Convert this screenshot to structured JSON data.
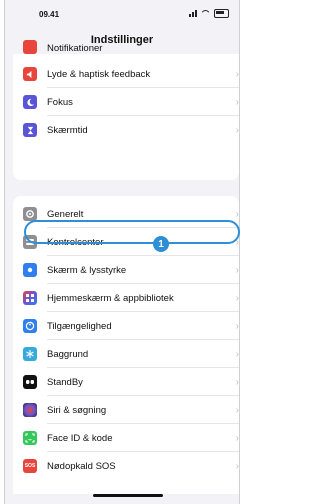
{
  "status": {
    "time": "09.41"
  },
  "header": {
    "title": "Indstillinger"
  },
  "group1": [
    {
      "label": "Notifikationer",
      "icon": "bell-icon",
      "color": "#e8453c"
    },
    {
      "label": "Lyde & haptisk feedback",
      "icon": "speaker-icon",
      "color": "#e8453c"
    },
    {
      "label": "Fokus",
      "icon": "moon-icon",
      "color": "#5a55d6"
    },
    {
      "label": "Skærmtid",
      "icon": "hourglass-icon",
      "color": "#5a55d6"
    }
  ],
  "group2": [
    {
      "label": "Generelt",
      "icon": "gear-icon",
      "color": "#8e8e93"
    },
    {
      "label": "Kontrolcenter",
      "icon": "control-center-icon",
      "color": "#8e8e93"
    },
    {
      "label": "Skærm & lysstyrke",
      "icon": "sun-icon",
      "color": "#2f80ed"
    },
    {
      "label": "Hjemmeskærm & appbibliotek",
      "icon": "grid-icon",
      "color": "#6a55d6"
    },
    {
      "label": "Tilgængelighed",
      "icon": "accessibility-icon",
      "color": "#2f80ed"
    },
    {
      "label": "Baggrund",
      "icon": "snowflake-icon",
      "color": "#36aadc"
    },
    {
      "label": "StandBy",
      "icon": "standby-icon",
      "color": "#111111"
    },
    {
      "label": "Siri & søgning",
      "icon": "siri-icon",
      "color": "#333344"
    },
    {
      "label": "Face ID & kode",
      "icon": "face-id-icon",
      "color": "#34c759"
    },
    {
      "label": "Nødopkald SOS",
      "icon": "sos-icon",
      "color": "#e8453c"
    }
  ],
  "callout": {
    "number": "1"
  },
  "glyphs": {
    "chevron": "›",
    "sos": "SOS"
  },
  "colors": {
    "accent": "#2f8fd6",
    "background": "#f2f2f7"
  }
}
